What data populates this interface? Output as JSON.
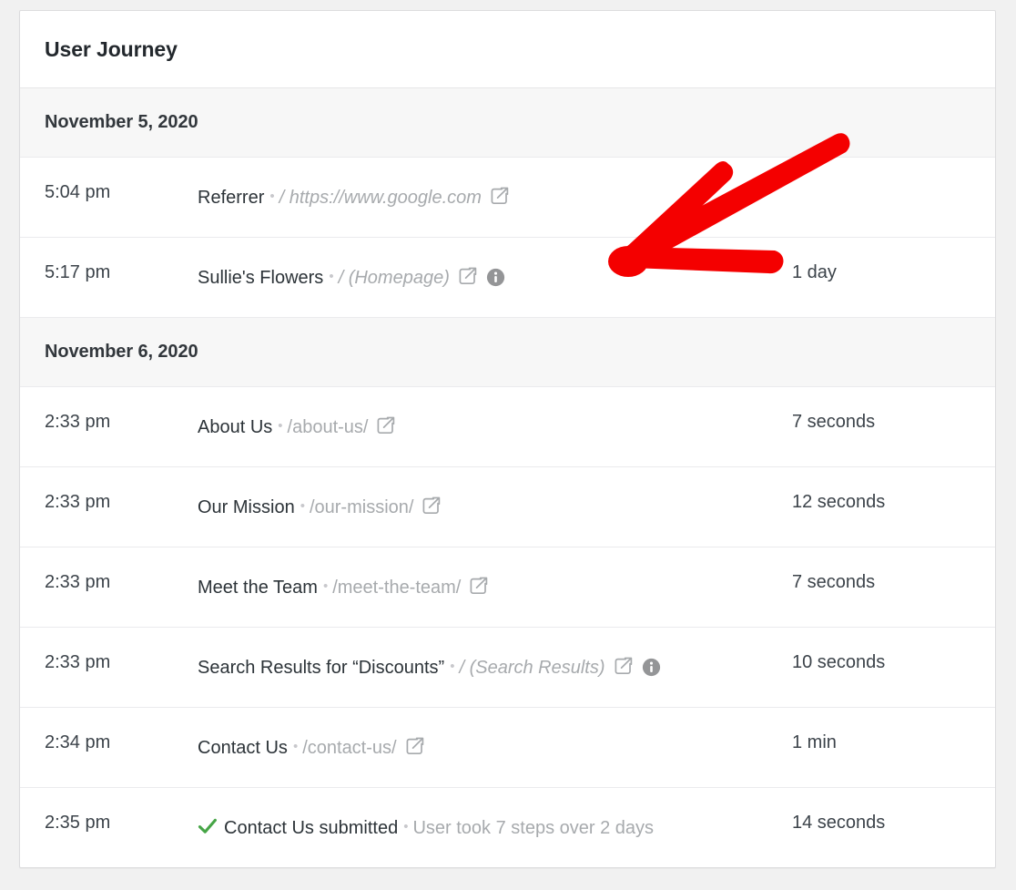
{
  "card": {
    "title": "User Journey"
  },
  "colors": {
    "page_background": "#f1f1f1",
    "card_background": "#ffffff",
    "date_header_background": "#f7f7f7",
    "border": "#dcdcde",
    "title_text": "#23282d",
    "muted_text": "#a7aaad",
    "icon_gray": "#a7aaad",
    "info_icon_gray": "#949597",
    "check_green": "#46a546",
    "annotation_red": "#f40000"
  },
  "icons": {
    "external_link": "external-link-icon",
    "info": "info-icon",
    "check": "check-icon"
  },
  "groups": [
    {
      "date": "November 5, 2020",
      "rows": [
        {
          "time": "5:04 pm",
          "title": "Referrer",
          "separator": "•",
          "url": "/ https://www.google.com",
          "url_italic": true,
          "has_external_link": true,
          "has_info": false,
          "has_check": false,
          "duration": ""
        },
        {
          "time": "5:17 pm",
          "title": "Sullie's Flowers",
          "separator": "•",
          "url": "/ (Homepage)",
          "url_italic": true,
          "has_external_link": true,
          "has_info": true,
          "has_check": false,
          "duration": "1 day"
        }
      ]
    },
    {
      "date": "November 6, 2020",
      "rows": [
        {
          "time": "2:33 pm",
          "title": "About Us",
          "separator": "•",
          "url": "/about-us/",
          "url_italic": false,
          "has_external_link": true,
          "has_info": false,
          "has_check": false,
          "duration": "7 seconds"
        },
        {
          "time": "2:33 pm",
          "title": "Our Mission",
          "separator": "•",
          "url": "/our-mission/",
          "url_italic": false,
          "has_external_link": true,
          "has_info": false,
          "has_check": false,
          "duration": "12 seconds"
        },
        {
          "time": "2:33 pm",
          "title": "Meet the Team",
          "separator": "•",
          "url": "/meet-the-team/",
          "url_italic": false,
          "has_external_link": true,
          "has_info": false,
          "has_check": false,
          "duration": "7 seconds"
        },
        {
          "time": "2:33 pm",
          "title": "Search Results for “Discounts”",
          "separator": "•",
          "url": "/ (Search Results)",
          "url_italic": true,
          "has_external_link": true,
          "has_info": true,
          "has_check": false,
          "duration": "10 seconds"
        },
        {
          "time": "2:34 pm",
          "title": "Contact Us",
          "separator": "•",
          "url": "/contact-us/",
          "url_italic": false,
          "has_external_link": true,
          "has_info": false,
          "has_check": false,
          "duration": "1 min"
        },
        {
          "time": "2:35 pm",
          "title": "Contact Us submitted",
          "separator": "•",
          "url": "User took 7 steps over 2 days",
          "url_italic": false,
          "has_external_link": false,
          "has_info": false,
          "has_check": true,
          "duration": "14 seconds"
        }
      ]
    }
  ],
  "annotation": {
    "type": "hand-drawn-arrow",
    "color": "#f40000",
    "points_to": "info-icon on Sullie's Flowers row"
  }
}
